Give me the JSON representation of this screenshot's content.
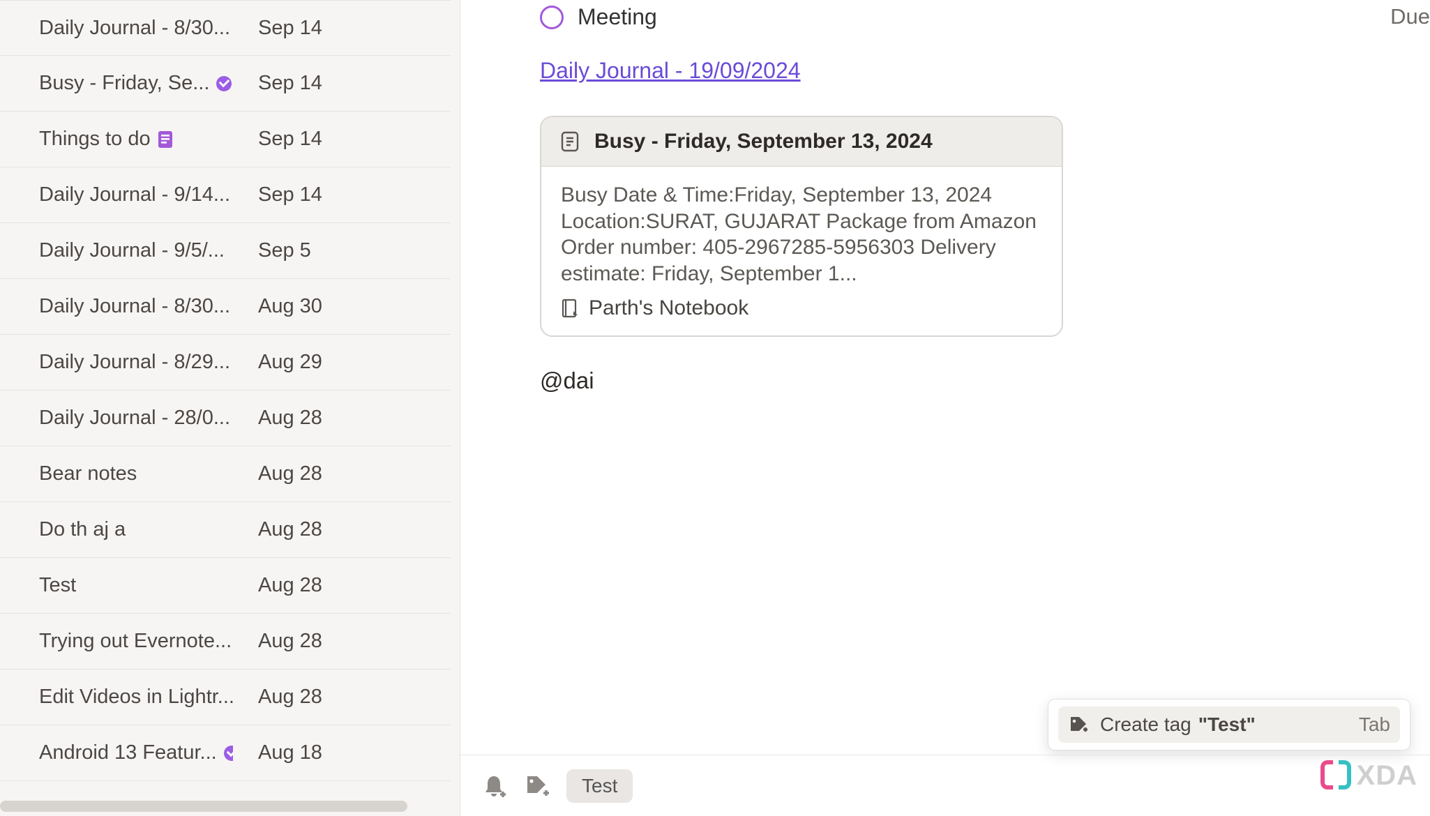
{
  "sidebar": {
    "notes": [
      {
        "title": "Daily Journal - 8/30...",
        "date": "Sep 14",
        "badge": null
      },
      {
        "title": "Busy - Friday, Se...",
        "date": "Sep 14",
        "badge": "check"
      },
      {
        "title": "Things to do",
        "date": "Sep 14",
        "badge": "note"
      },
      {
        "title": "Daily Journal - 9/14...",
        "date": "Sep 14",
        "badge": null
      },
      {
        "title": "Daily Journal - 9/5/...",
        "date": "Sep 5",
        "badge": null
      },
      {
        "title": "Daily Journal - 8/30...",
        "date": "Aug 30",
        "badge": null
      },
      {
        "title": "Daily Journal - 8/29...",
        "date": "Aug 29",
        "badge": null
      },
      {
        "title": "Daily Journal - 28/0...",
        "date": "Aug 28",
        "badge": null
      },
      {
        "title": "Bear notes",
        "date": "Aug 28",
        "badge": null
      },
      {
        "title": "Do th aj a",
        "date": "Aug 28",
        "badge": null
      },
      {
        "title": "Test",
        "date": "Aug 28",
        "badge": null
      },
      {
        "title": "Trying out Evernote...",
        "date": "Aug 28",
        "badge": null
      },
      {
        "title": "Edit Videos in Lightr...",
        "date": "Aug 28",
        "badge": null
      },
      {
        "title": "Android 13 Featur...",
        "date": "Aug 18",
        "badge": "check"
      }
    ]
  },
  "editor": {
    "due_label": "Due",
    "checkbox_label": "Meeting",
    "link_text": "Daily Journal - 19/09/2024",
    "card": {
      "title": "Busy - Friday, September 13, 2024",
      "snippet": "Busy Date & Time:Friday, September 13, 2024 Location:SURAT, GUJARAT Package from Amazon Order number: 405-2967285-5956303 Delivery estimate: Friday, September 1...",
      "notebook": "Parth's Notebook"
    },
    "mention_text": "@dai"
  },
  "bottom": {
    "tag_input": "Test",
    "suggest_prefix": "Create tag",
    "suggest_value": "\"Test\"",
    "suggest_key": "Tab"
  },
  "watermark": {
    "text": "XDA"
  }
}
